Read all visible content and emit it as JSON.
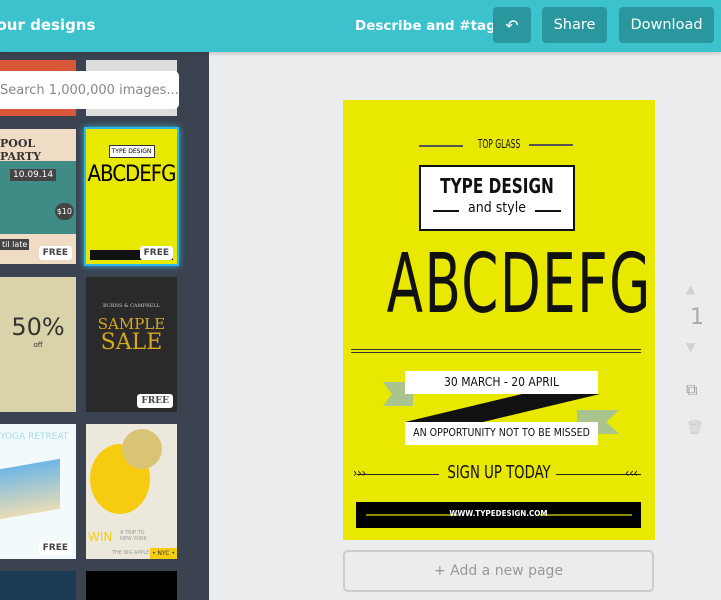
{
  "header": {
    "designs_link": "Your designs",
    "describe": "Describe and #tag",
    "undo_icon": "undo-icon",
    "share": "Share",
    "download": "Download"
  },
  "sidebar": {
    "search_placeholder": "Search 1,000,000 images...",
    "free_badge": "FREE",
    "thumbs": {
      "pool_title": "POOL PARTY",
      "pool_date": "10.09.14",
      "pool_price": "$10",
      "pool_late": "til late",
      "sale_percent": "50%",
      "sale_off": "off",
      "sample": "SAMPLE",
      "sale": "SALE",
      "burns": "BURNS & CAMPBELL",
      "yoga": "YOGA RETREAT",
      "win": "WIN",
      "trip": "A TRIP TO NEW YORK",
      "nyc": "• NYC •",
      "big_apple": "THE BIG APPLE",
      "type_design": "TYPE DESIGN",
      "abc": "ABCDEFG"
    }
  },
  "poster": {
    "top": "TOP GLASS",
    "title": "TYPE DESIGN",
    "subtitle": "and style",
    "letters": "ABCDEFG",
    "dates": "30 MARCH - 20 APRIL",
    "tagline": "AN OPPORTUNITY NOT TO BE MISSED",
    "cta": "SIGN UP TODAY",
    "url": "WWW.TYPEDESIGN.COM",
    "bg": "#e8e800"
  },
  "add_page": "+ Add a new page",
  "page_controls": {
    "page_number": "1"
  }
}
